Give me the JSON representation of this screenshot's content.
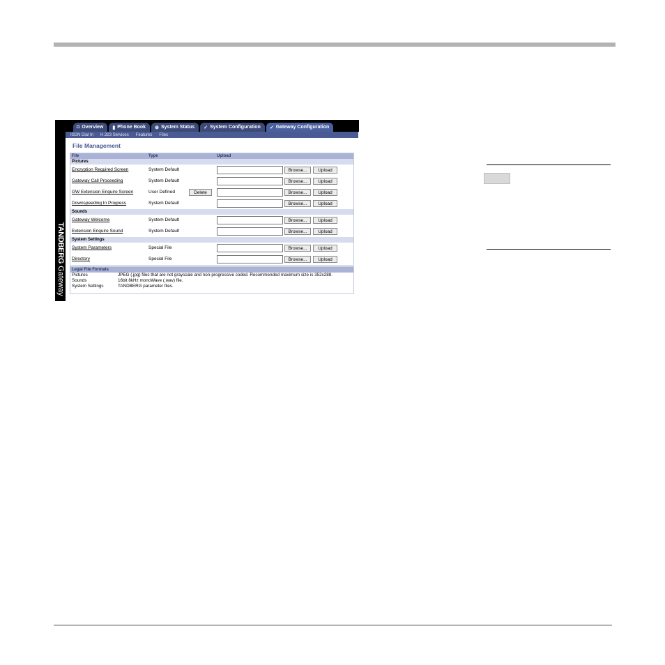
{
  "brand": {
    "name": "TANDBERG",
    "product": "Gateway"
  },
  "tabs": [
    {
      "label": "Overview",
      "icon": "overview-icon",
      "glyph": "◘"
    },
    {
      "label": "Phone Book",
      "icon": "phone-book-icon",
      "glyph": "▮"
    },
    {
      "label": "System Status",
      "icon": "status-icon",
      "glyph": "⊕"
    },
    {
      "label": "System Configuration",
      "icon": "wrench-icon",
      "glyph": "✓"
    },
    {
      "label": "Gateway Configuration",
      "icon": "wrench-icon",
      "glyph": "✓"
    }
  ],
  "subnav": [
    "ISDN Dial In",
    "H.323 Services",
    "Features",
    "Files"
  ],
  "page": {
    "title": "File Management"
  },
  "table": {
    "headers": {
      "file": "File",
      "type": "Type",
      "upload": "Upload"
    },
    "browse_label": "Browse...",
    "upload_label": "Upload",
    "delete_label": "Delete",
    "sections": [
      {
        "name": "Pictures",
        "rows": [
          {
            "file": "Encryption Required Screen",
            "type": "System Default"
          },
          {
            "file": "Gateway Call Proceeding",
            "type": "System Default"
          },
          {
            "file": "GW Extension Enquire Screen",
            "type": "User Defined",
            "deletable": true
          },
          {
            "file": "Downspeeding In Progress",
            "type": "System Default"
          }
        ]
      },
      {
        "name": "Sounds",
        "rows": [
          {
            "file": "Gateway Welcome",
            "type": "System Default"
          },
          {
            "file": "Extension Enquire Sound",
            "type": "System Default"
          }
        ]
      },
      {
        "name": "System Settings",
        "rows": [
          {
            "file": "System Parameters",
            "type": "Special File"
          },
          {
            "file": "Directory",
            "type": "Special File"
          }
        ]
      }
    ]
  },
  "legal": {
    "title": "Legal File Formats",
    "rows": [
      {
        "k": "Pictures",
        "v": "JPEG (.jpg) files that are not grayscale and non-progressive coded. Recommended maximum size is 352x288."
      },
      {
        "k": "Sounds",
        "v": "16bit 8kHz monoWave (.wav) file."
      },
      {
        "k": "System Settings",
        "v": "TANDBERG parameter files."
      }
    ]
  }
}
